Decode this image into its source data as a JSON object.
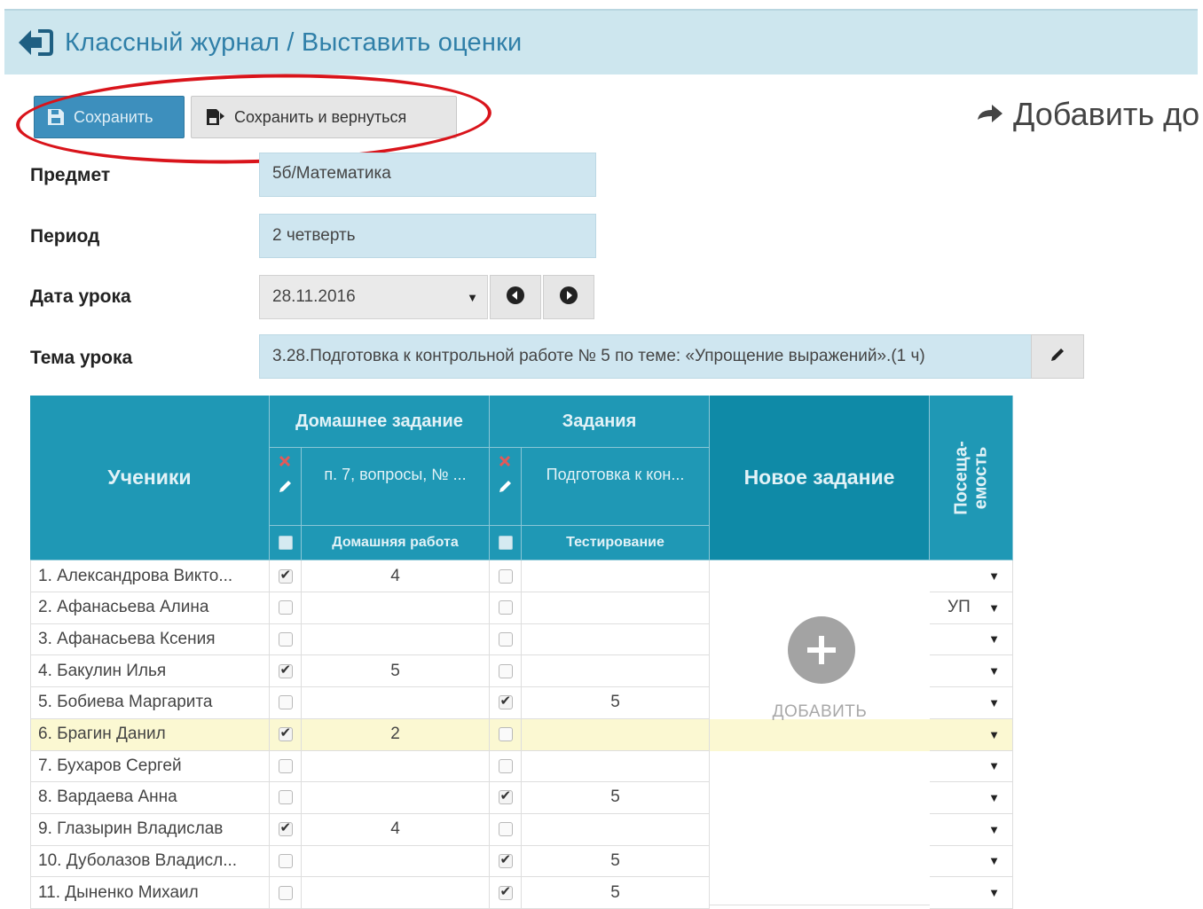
{
  "header": {
    "title": "Классный журнал / Выставить оценки"
  },
  "toolbar": {
    "save_label": "Сохранить",
    "save_return_label": "Сохранить и вернуться",
    "add_link_label": "Добавить до"
  },
  "form": {
    "subject_label": "Предмет",
    "subject_value": "5б/Математика",
    "period_label": "Период",
    "period_value": "2 четверть",
    "date_label": "Дата урока",
    "date_value": "28.11.2016",
    "topic_label": "Тема урока",
    "topic_value": "3.28.Подготовка к контрольной работе № 5 по теме: «Упрощение выражений».(1 ч)"
  },
  "table": {
    "students_header": "Ученики",
    "homework_header": "Домашнее задание",
    "homework_task": "п. 7, вопросы, № ...",
    "homework_type": "Домашняя работа",
    "tasks_header": "Задания",
    "tasks_task": "Подготовка к кон...",
    "tasks_type": "Тестирование",
    "new_task_header": "Новое задание",
    "attendance_header_line1": "Посеща-",
    "attendance_header_line2": "емость",
    "add_label": "ДОБАВИТЬ",
    "rows": [
      {
        "name": "1. Александрова Викто...",
        "hw_checked": true,
        "hw_grade": "4",
        "task_checked": false,
        "task_grade": "",
        "attendance": ""
      },
      {
        "name": "2. Афанасьева Алина",
        "hw_checked": false,
        "hw_grade": "",
        "task_checked": false,
        "task_grade": "",
        "attendance": "УП"
      },
      {
        "name": "3. Афанасьева Ксения",
        "hw_checked": false,
        "hw_grade": "",
        "task_checked": false,
        "task_grade": "",
        "attendance": ""
      },
      {
        "name": "4. Бакулин Илья",
        "hw_checked": true,
        "hw_grade": "5",
        "task_checked": false,
        "task_grade": "",
        "attendance": ""
      },
      {
        "name": "5. Бобиева Маргарита",
        "hw_checked": false,
        "hw_grade": "",
        "task_checked": true,
        "task_grade": "5",
        "attendance": ""
      },
      {
        "name": "6. Брагин Данил",
        "hw_checked": true,
        "hw_grade": "2",
        "task_checked": false,
        "task_grade": "",
        "attendance": ""
      },
      {
        "name": "7. Бухаров Сергей",
        "hw_checked": false,
        "hw_grade": "",
        "task_checked": false,
        "task_grade": "",
        "attendance": ""
      },
      {
        "name": "8. Вардаева Анна",
        "hw_checked": false,
        "hw_grade": "",
        "task_checked": true,
        "task_grade": "5",
        "attendance": ""
      },
      {
        "name": "9. Глазырин Владислав",
        "hw_checked": true,
        "hw_grade": "4",
        "task_checked": false,
        "task_grade": "",
        "attendance": ""
      },
      {
        "name": "10. Дуболазов Владисл...",
        "hw_checked": false,
        "hw_grade": "",
        "task_checked": true,
        "task_grade": "5",
        "attendance": ""
      },
      {
        "name": "11. Дыненко Михаил",
        "hw_checked": false,
        "hw_grade": "",
        "task_checked": true,
        "task_grade": "5",
        "attendance": ""
      }
    ],
    "highlighted_row": 5
  },
  "colors": {
    "header_bg": "#cde6ee",
    "title_color": "#2f7fa8",
    "table_header": "#1f98b5",
    "primary_button": "#3d8fbd",
    "annotation_red": "#d9141b",
    "highlight_row": "#fbf8d2"
  },
  "icons": {
    "back": "sign-out-back-icon",
    "save": "floppy-disk-icon",
    "add_link": "arrow-right-icon",
    "date_prev": "circle-arrow-left-icon",
    "date_next": "circle-arrow-right-icon",
    "edit": "pencil-icon",
    "remove": "red-x-icon",
    "add": "plus-circle-icon",
    "dropdown": "caret-down-icon"
  }
}
